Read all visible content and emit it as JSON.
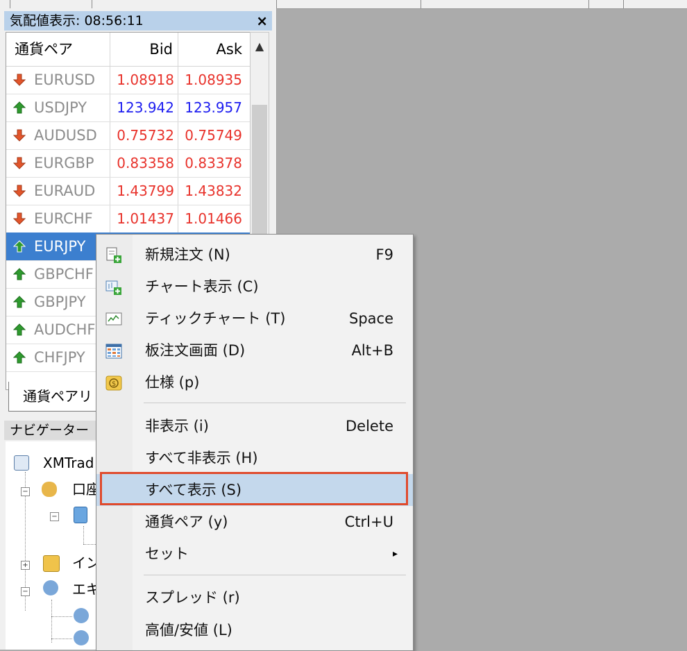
{
  "market_watch": {
    "title": "気配値表示: 08:56:11",
    "close_glyph": "×",
    "columns": [
      "通貨ペア",
      "Bid",
      "Ask"
    ],
    "rows": [
      {
        "symbol": "EURUSD",
        "bid": "1.08918",
        "ask": "1.08935",
        "direction": "down"
      },
      {
        "symbol": "USDJPY",
        "bid": "123.942",
        "ask": "123.957",
        "direction": "up"
      },
      {
        "symbol": "AUDUSD",
        "bid": "0.75732",
        "ask": "0.75749",
        "direction": "down"
      },
      {
        "symbol": "EURGBP",
        "bid": "0.83358",
        "ask": "0.83378",
        "direction": "down"
      },
      {
        "symbol": "EURAUD",
        "bid": "1.43799",
        "ask": "1.43832",
        "direction": "down"
      },
      {
        "symbol": "EURCHF",
        "bid": "1.01437",
        "ask": "1.01466",
        "direction": "down"
      },
      {
        "symbol": "EURJPY",
        "bid": "",
        "ask": "",
        "direction": "up",
        "selected": true
      },
      {
        "symbol": "GBPCHF",
        "bid": "",
        "ask": "",
        "direction": "up"
      },
      {
        "symbol": "GBPJPY",
        "bid": "",
        "ask": "",
        "direction": "up"
      },
      {
        "symbol": "AUDCHF",
        "bid": "",
        "ask": "",
        "direction": "up"
      },
      {
        "symbol": "CHFJPY",
        "bid": "",
        "ask": "",
        "direction": "up"
      }
    ],
    "tab_label": "通貨ペアリ"
  },
  "navigator": {
    "title": "ナビゲーター",
    "items": [
      "XMTrad",
      "口座",
      "イン",
      "エキ"
    ],
    "expanders": {
      "minus": "−",
      "plus": "+"
    }
  },
  "context_menu": {
    "items": [
      {
        "label": "新規注文 (N)",
        "shortcut": "F9",
        "icon": "new-order-icon"
      },
      {
        "label": "チャート表示 (C)",
        "shortcut": "",
        "icon": "chart-window-icon"
      },
      {
        "label": "ティックチャート (T)",
        "shortcut": "Space",
        "icon": "tick-chart-icon"
      },
      {
        "label": "板注文画面 (D)",
        "shortcut": "Alt+B",
        "icon": "depth-of-market-icon"
      },
      {
        "label": "仕様 (p)",
        "shortcut": "",
        "icon": "dollar-spec-icon"
      },
      {
        "label": "非表示 (i)",
        "shortcut": "Delete"
      },
      {
        "label": "すべて非表示 (H)",
        "shortcut": ""
      },
      {
        "label": "すべて表示 (S)",
        "shortcut": "",
        "highlighted": true
      },
      {
        "label": "通貨ペア (y)",
        "shortcut": "Ctrl+U"
      },
      {
        "label": "セット",
        "shortcut": "",
        "submenu_arrow": "▸"
      },
      {
        "label": "スプレッド (r)",
        "shortcut": ""
      },
      {
        "label": "高値/安値 (L)",
        "shortcut": ""
      }
    ]
  },
  "colors": {
    "price_down": "#e8322b",
    "price_up": "#1c1cf0",
    "selection": "#3c7fcf",
    "highlight_box": "#e04a2c"
  }
}
